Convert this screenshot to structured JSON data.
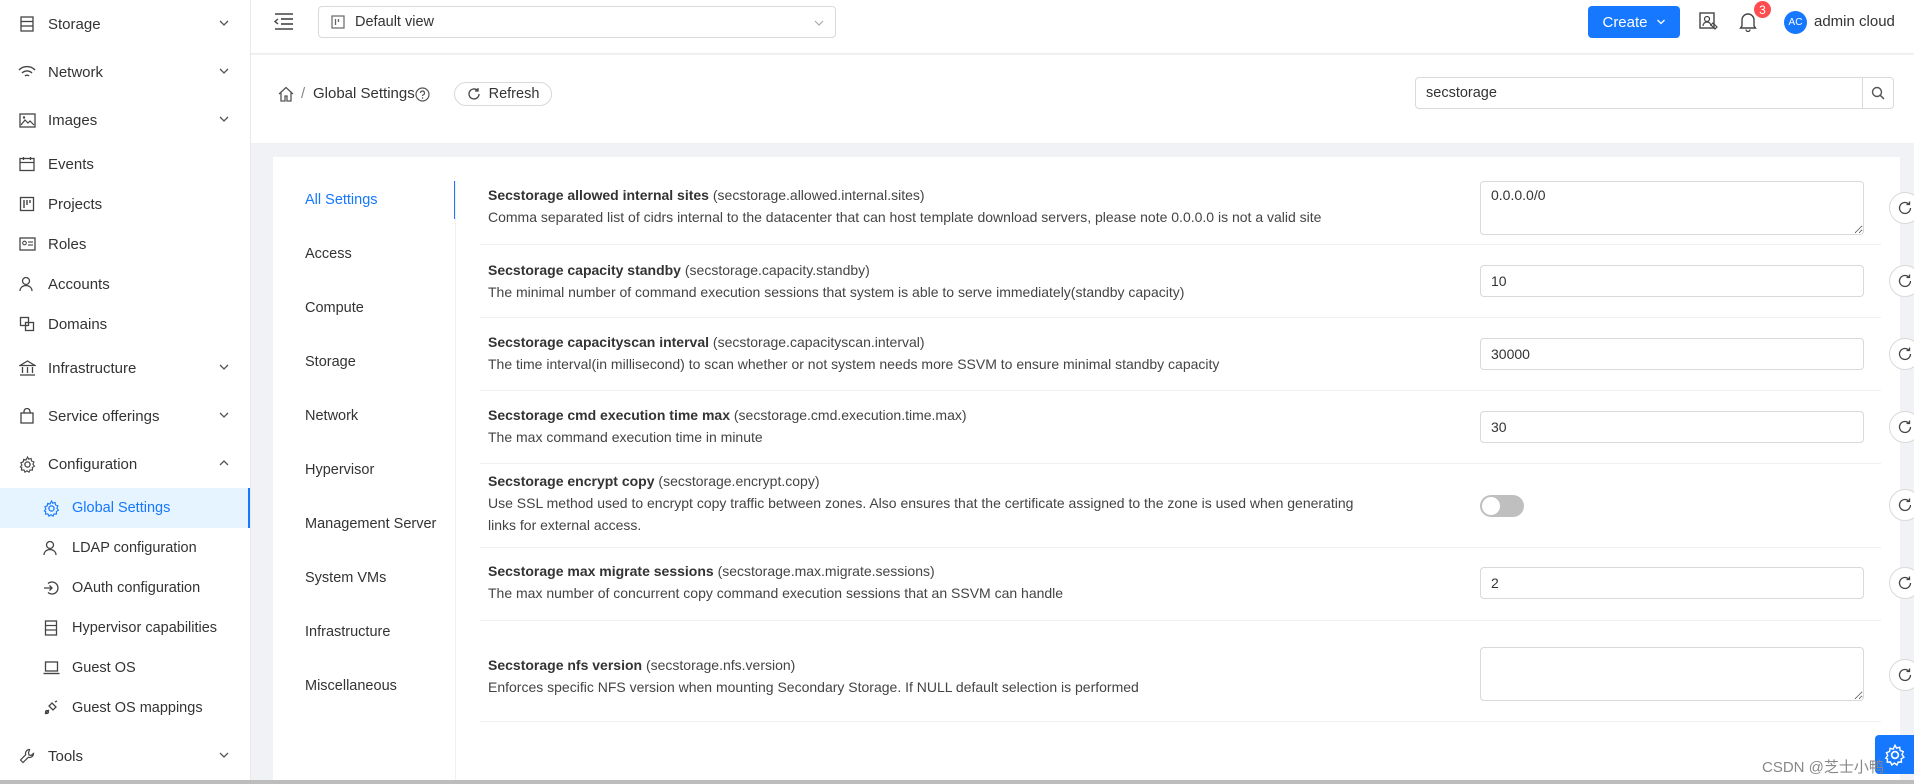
{
  "sidebar": {
    "items": [
      {
        "label": "Storage",
        "icon": "storage-icon",
        "chevron": "down"
      },
      {
        "label": "Network",
        "icon": "wifi-icon",
        "chevron": "down"
      },
      {
        "label": "Images",
        "icon": "image-icon",
        "chevron": "down"
      },
      {
        "label": "Events",
        "icon": "calendar-icon"
      },
      {
        "label": "Projects",
        "icon": "project-icon"
      },
      {
        "label": "Roles",
        "icon": "idcard-icon"
      },
      {
        "label": "Accounts",
        "icon": "user-icon"
      },
      {
        "label": "Domains",
        "icon": "block-icon"
      },
      {
        "label": "Infrastructure",
        "icon": "bank-icon",
        "chevron": "down"
      },
      {
        "label": "Service offerings",
        "icon": "shopping-icon",
        "chevron": "down"
      },
      {
        "label": "Configuration",
        "icon": "gear-icon",
        "chevron": "up"
      }
    ],
    "sub_items": [
      {
        "label": "Global Settings",
        "icon": "gear-icon",
        "active": true
      },
      {
        "label": "LDAP configuration",
        "icon": "user-icon"
      },
      {
        "label": "OAuth configuration",
        "icon": "login-icon"
      },
      {
        "label": "Hypervisor capabilities",
        "icon": "database-icon"
      },
      {
        "label": "Guest OS",
        "icon": "laptop-icon"
      },
      {
        "label": "Guest OS mappings",
        "icon": "api-icon"
      }
    ],
    "tools": {
      "label": "Tools",
      "icon": "tool-icon",
      "chevron": "down"
    }
  },
  "header": {
    "view_select": "Default view",
    "create_label": "Create",
    "notification_count": "3",
    "avatar_initials": "AC",
    "username": "admin cloud"
  },
  "breadcrumb": {
    "current": "Global Settings",
    "separator": "/",
    "refresh_label": "Refresh"
  },
  "search": {
    "value": "secstorage"
  },
  "categories": [
    "All Settings",
    "Access",
    "Compute",
    "Storage",
    "Network",
    "Hypervisor",
    "Management Server",
    "System VMs",
    "Infrastructure",
    "Miscellaneous"
  ],
  "settings": [
    {
      "name": "Secstorage allowed internal sites",
      "key": "(secstorage.allowed.internal.sites)",
      "desc": "Comma separated list of cidrs internal to the datacenter that can host template download servers, please note 0.0.0.0 is not a valid site",
      "type": "textarea",
      "value": "0.0.0.0/0"
    },
    {
      "name": "Secstorage capacity standby",
      "key": "(secstorage.capacity.standby)",
      "desc": "The minimal number of command execution sessions that system is able to serve immediately(standby capacity)",
      "type": "input",
      "value": "10"
    },
    {
      "name": "Secstorage capacityscan interval",
      "key": "(secstorage.capacityscan.interval)",
      "desc": "The time interval(in millisecond) to scan whether or not system needs more SSVM to ensure minimal standby capacity",
      "type": "input",
      "value": "30000"
    },
    {
      "name": "Secstorage cmd execution time max",
      "key": "(secstorage.cmd.execution.time.max)",
      "desc": "The max command execution time in minute",
      "type": "input",
      "value": "30"
    },
    {
      "name": "Secstorage encrypt copy",
      "key": "(secstorage.encrypt.copy)",
      "desc": "Use SSL method used to encrypt copy traffic between zones. Also ensures that the certificate assigned to the zone is used when generating links for external access.",
      "type": "toggle",
      "value": "off"
    },
    {
      "name": "Secstorage max migrate sessions",
      "key": "(secstorage.max.migrate.sessions)",
      "desc": "The max number of concurrent copy command execution sessions that an SSVM can handle",
      "type": "input",
      "value": "2"
    },
    {
      "name": "Secstorage nfs version",
      "key": "(secstorage.nfs.version)",
      "desc": "Enforces specific NFS version when mounting Secondary Storage. If NULL default selection is performed",
      "type": "textarea",
      "value": ""
    }
  ],
  "watermark": "CSDN @芝士小鸭",
  "colors": {
    "primary": "#1677ff",
    "badge": "#ff4d4f"
  }
}
